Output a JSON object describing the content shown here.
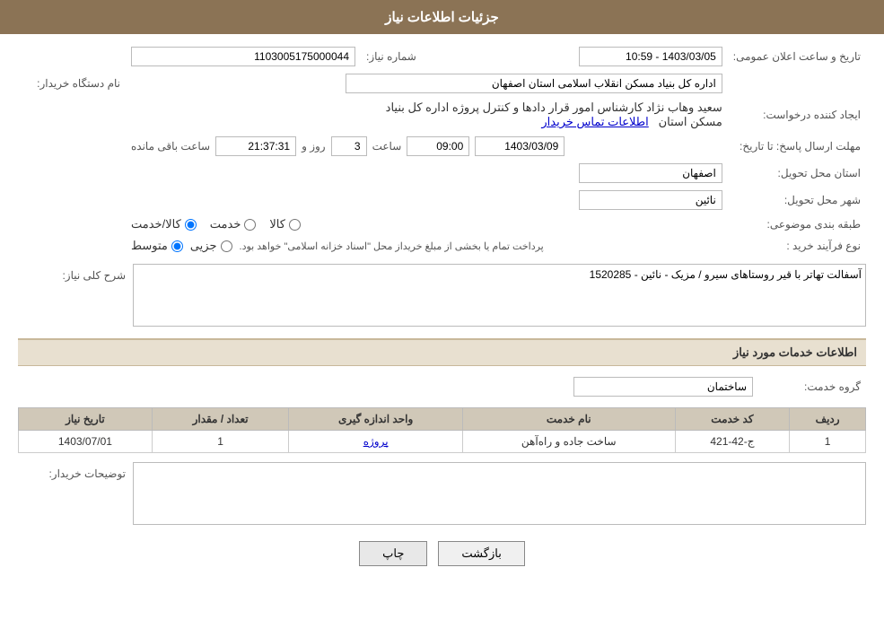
{
  "header": {
    "title": "جزئیات اطلاعات نیاز"
  },
  "fields": {
    "need_number_label": "شماره نیاز:",
    "need_number_value": "1103005175000044",
    "buyer_label": "نام دستگاه خریدار:",
    "buyer_value": "اداره کل بنیاد مسکن انقلاب اسلامی استان اصفهان",
    "requester_label": "ایجاد کننده درخواست:",
    "requester_value": "سعید وهاب نژاد کارشناس امور قرار دادها و کنترل  پروژه اداره کل بنیاد مسکن استان",
    "requester_link": "اطلاعات تماس خریدار",
    "announce_date_label": "تاریخ و ساعت اعلان عمومی:",
    "announce_date_value": "1403/03/05 - 10:59",
    "reply_deadline_label": "مهلت ارسال پاسخ: تا تاریخ:",
    "reply_date": "1403/03/09",
    "reply_time": "09:00",
    "reply_days": "3",
    "reply_remaining": "21:37:31",
    "reply_remaining_label_before": "روز و",
    "reply_remaining_label_after": "ساعت باقی مانده",
    "province_label": "استان محل تحویل:",
    "province_value": "اصفهان",
    "city_label": "شهر محل تحویل:",
    "city_value": "نائین",
    "category_label": "طبقه بندی موضوعی:",
    "category_options": [
      {
        "label": "کالا",
        "value": "kala",
        "checked": false
      },
      {
        "label": "خدمت",
        "value": "khedmat",
        "checked": false
      },
      {
        "label": "کالا/خدمت",
        "value": "kala_khedmat",
        "checked": true
      }
    ],
    "purchase_type_label": "نوع فرآیند خرید :",
    "purchase_type_options": [
      {
        "label": "جزیی",
        "value": "jozi",
        "checked": false
      },
      {
        "label": "متوسط",
        "value": "motavaset",
        "checked": true
      }
    ],
    "purchase_type_note": "پرداخت تمام یا بخشی از مبلغ خریداز محل \"اسناد خزانه اسلامی\" خواهد بود.",
    "need_description_label": "شرح کلی نیاز:",
    "need_description_value": "آسفالت تهاتر با قیر روستاهای سیرو / مزیک - نائین - 1520285",
    "service_info_title": "اطلاعات خدمات مورد نیاز",
    "service_group_label": "گروه خدمت:",
    "service_group_value": "ساختمان",
    "table": {
      "headers": [
        "ردیف",
        "کد خدمت",
        "نام خدمت",
        "واحد اندازه گیری",
        "تعداد / مقدار",
        "تاریخ نیاز"
      ],
      "rows": [
        {
          "row": "1",
          "code": "ج-42-421",
          "name": "ساخت جاده و راه‌آهن",
          "unit": "پروژه",
          "qty": "1",
          "date": "1403/07/01"
        }
      ]
    },
    "buyer_desc_label": "توضیحات خریدار:",
    "buyer_desc_value": ""
  },
  "buttons": {
    "print": "چاپ",
    "back": "بازگشت"
  }
}
